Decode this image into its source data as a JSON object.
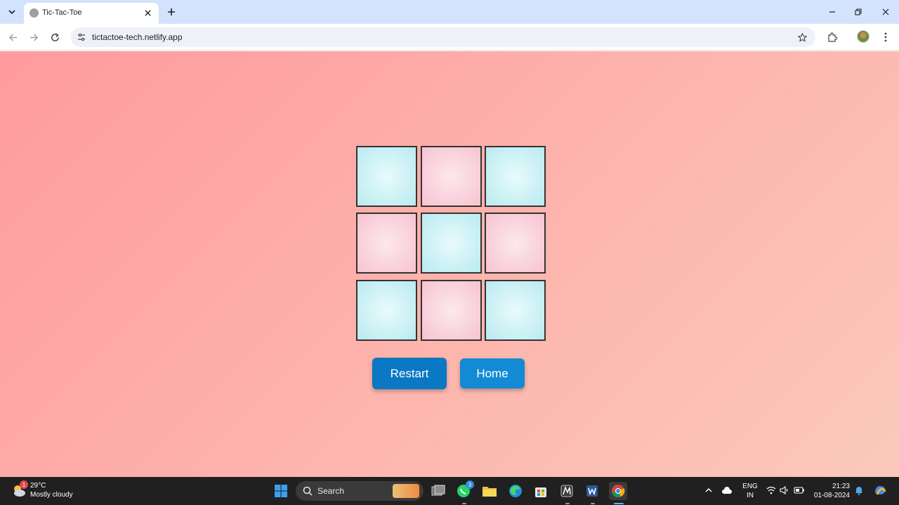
{
  "browser": {
    "tab": {
      "title": "Tic-Tac-Toe"
    },
    "url": "tictactoe-tech.netlify.app"
  },
  "game": {
    "cells": [
      {
        "color": "blue"
      },
      {
        "color": "pink"
      },
      {
        "color": "blue"
      },
      {
        "color": "pink"
      },
      {
        "color": "blue"
      },
      {
        "color": "pink"
      },
      {
        "color": "blue"
      },
      {
        "color": "pink"
      },
      {
        "color": "blue"
      }
    ],
    "restart_label": "Restart",
    "home_label": "Home"
  },
  "taskbar": {
    "weather": {
      "badge": "1",
      "temp": "29°C",
      "condition": "Mostly cloudy"
    },
    "search_label": "Search",
    "whatsapp_badge": "3",
    "language": {
      "line1": "ENG",
      "line2": "IN"
    },
    "clock": {
      "time": "21:23",
      "date": "01-08-2024"
    }
  },
  "colors": {
    "restart_button": "#0a78c2",
    "home_button": "#128bd4",
    "cell_blue": "#b9eaf0",
    "cell_pink": "#f6c3d0"
  }
}
